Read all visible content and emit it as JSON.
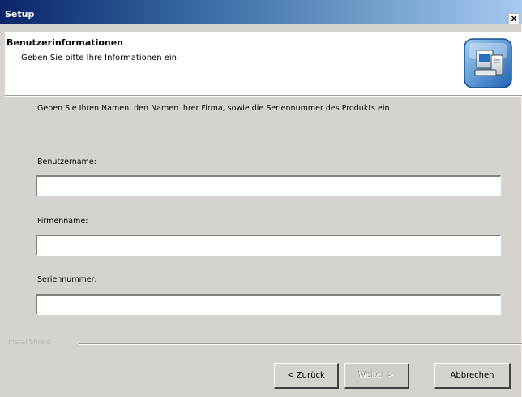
{
  "window": {
    "title": "Setup",
    "close_glyph": "x"
  },
  "header": {
    "title": "Benutzerinformationen",
    "subtitle": "Geben Sie bitte Ihre Informationen ein.",
    "icon": "computer-setup-icon"
  },
  "intro_text": "Geben Sie Ihren Namen, den Namen Ihrer Firma, sowie die Seriennummer des Produkts ein.",
  "fields": [
    {
      "label": "Benutzername:",
      "value": ""
    },
    {
      "label": "Firmenname:",
      "value": ""
    },
    {
      "label": "Seriennummer:",
      "value": ""
    }
  ],
  "footer": {
    "brand": "InstallShield"
  },
  "buttons": {
    "back": "< Zurück",
    "next": "Weiter >",
    "cancel": "Abbrechen"
  },
  "colors": {
    "title_gradient_start": "#0a246a",
    "title_gradient_end": "#a6caf0",
    "dialog_face": "#d6d3ce"
  }
}
